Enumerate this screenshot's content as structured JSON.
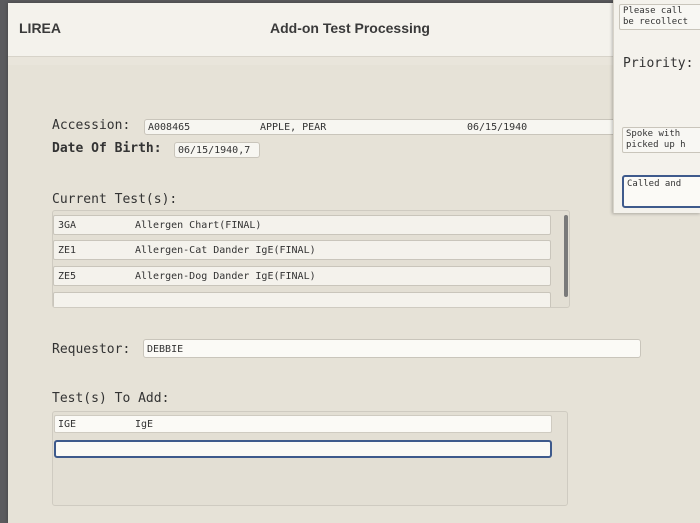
{
  "header": {
    "app_code": "LIREA",
    "title": "Add-on Test Processing"
  },
  "patient": {
    "accession_label": "Accession:",
    "accession_value": "A008465",
    "patient_name": "APPLE, PEAR",
    "dob_inline": "06/15/1940",
    "dob_label": "Date Of Birth:",
    "dob_value": "06/15/1940,7"
  },
  "current_tests": {
    "heading": "Current Test(s):",
    "rows": [
      {
        "code": "3GA",
        "name": "Allergen Chart(FINAL)"
      },
      {
        "code": "ZE1",
        "name": "Allergen-Cat Dander IgE(FINAL)"
      },
      {
        "code": "ZE5",
        "name": "Allergen-Dog Dander IgE(FINAL)"
      },
      {
        "code": "",
        "name": ""
      }
    ]
  },
  "requestor": {
    "label": "Requestor:",
    "value": "DEBBIE"
  },
  "tests_to_add": {
    "heading": "Test(s) To Add:",
    "rows": [
      {
        "code": "IGE",
        "name": "IgE"
      }
    ],
    "input_value": ""
  },
  "side_panel": {
    "note_line1": "Please call",
    "note_line2": "be recollect",
    "priority_label": "Priority:",
    "priority_value": "",
    "comment1_line1": "Spoke with",
    "comment1_line2": "picked up h",
    "comment2": "Called and"
  },
  "colors": {
    "desktop": "#5b5b5e",
    "window_bg": "#e6e2d7",
    "focus_border": "#3e5a8c"
  }
}
